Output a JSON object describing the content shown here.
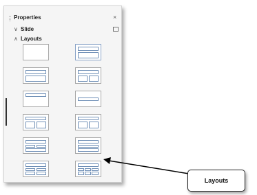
{
  "panel": {
    "title": "Properties",
    "close_glyph": "×",
    "sections": [
      {
        "label": "Slide",
        "expanded": false,
        "icon": "chevron-down-icon"
      },
      {
        "label": "Layouts",
        "expanded": true,
        "icon": "chevron-up-icon"
      }
    ],
    "layouts": [
      "blank",
      "title-content",
      "title-content-1",
      "title-two-content",
      "title-only",
      "centered-text",
      "two-column",
      "two-column-2",
      "title-two-rows",
      "title-content-rows",
      "four-content",
      "six-content"
    ]
  },
  "callout": {
    "label": "Layouts"
  },
  "colors": {
    "accent": "#6f8fb6",
    "panel_bg": "#f5f5f5"
  }
}
